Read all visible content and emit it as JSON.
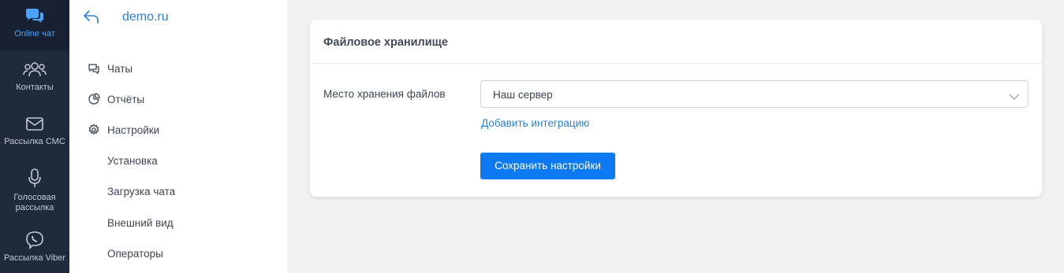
{
  "rail": {
    "items": [
      {
        "label": "Online чат",
        "icon": "chat-bubbles-icon",
        "active": true
      },
      {
        "label": "Контакты",
        "icon": "contacts-icon"
      },
      {
        "label": "Рассылка СМС",
        "icon": "envelope-icon"
      },
      {
        "label": "Голосовая рассылка",
        "icon": "microphone-icon"
      },
      {
        "label": "Рассылка Viber",
        "icon": "viber-icon"
      }
    ]
  },
  "sidebar": {
    "site_name": "demo.ru",
    "items": [
      {
        "label": "Чаты",
        "icon": "chat-icon"
      },
      {
        "label": "Отчёты",
        "icon": "pie-chart-icon"
      },
      {
        "label": "Настройки",
        "icon": "gear-icon"
      }
    ],
    "sub_items": [
      {
        "label": "Установка"
      },
      {
        "label": "Загрузка чата"
      },
      {
        "label": "Внешний вид"
      },
      {
        "label": "Операторы"
      }
    ]
  },
  "main": {
    "card_title": "Файловое хранилище",
    "storage_label": "Место хранения файлов",
    "storage_value": "Наш сервер",
    "add_integration": "Добавить интеграцию",
    "save_label": "Сохранить настройки"
  },
  "colors": {
    "accent": "#0d79f2",
    "rail_bg": "#1f2a3c",
    "link": "#2b7fd8"
  }
}
